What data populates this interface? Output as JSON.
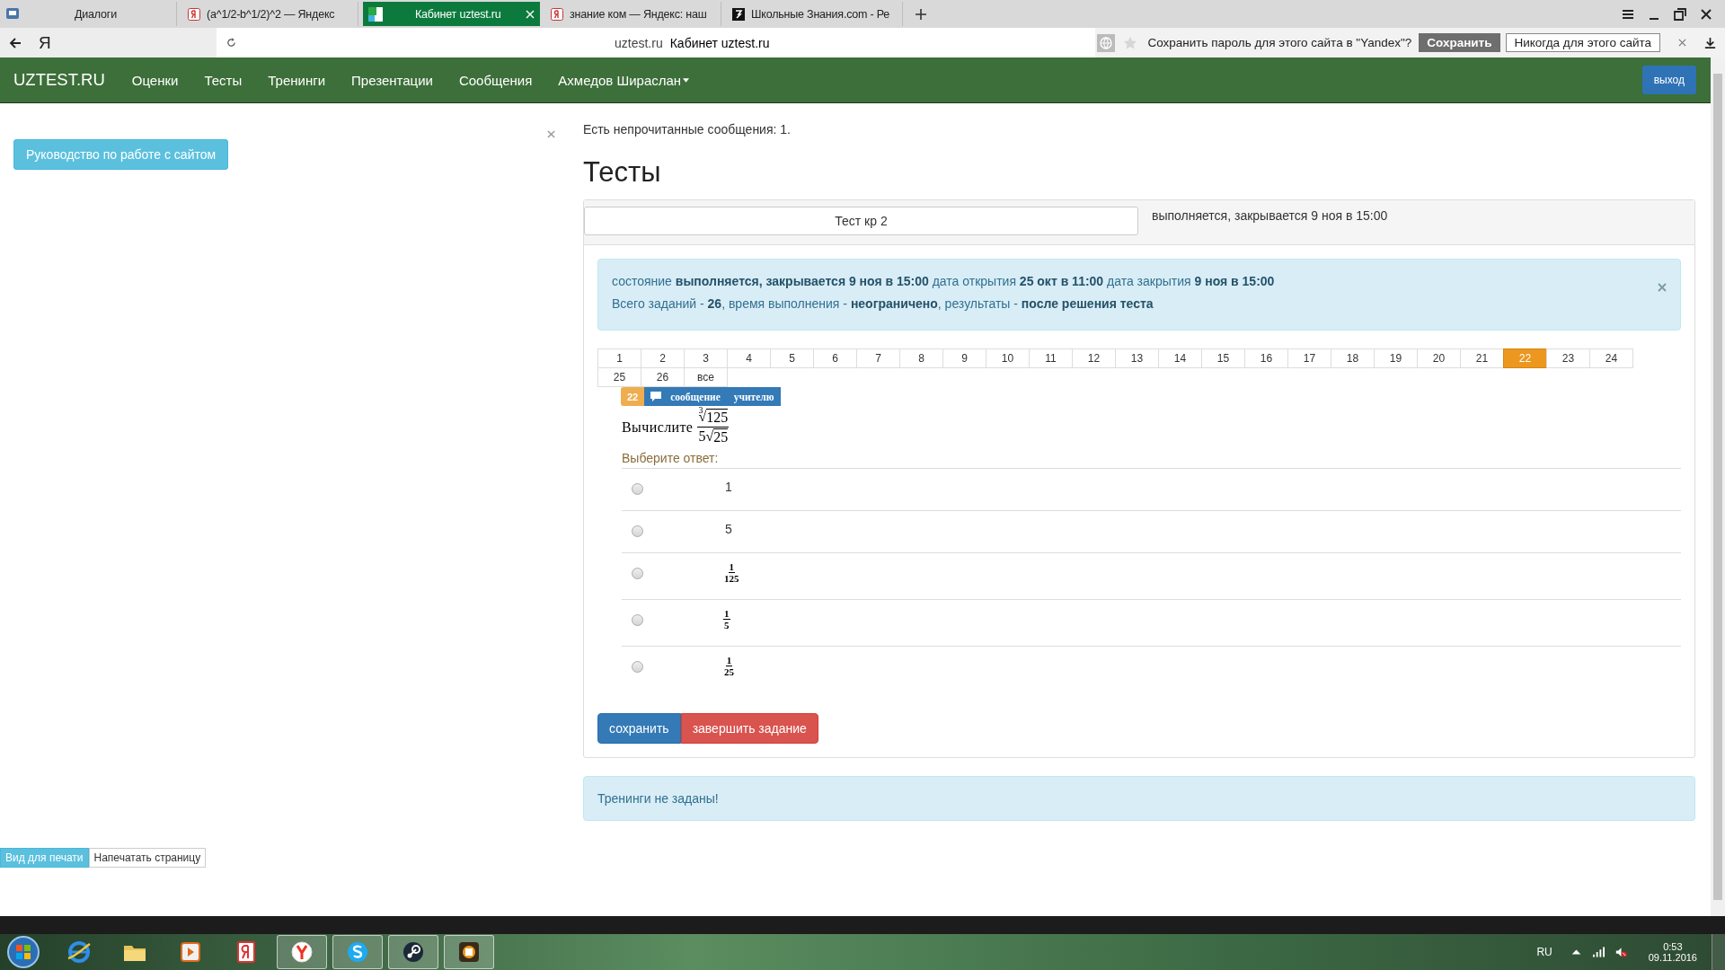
{
  "browser": {
    "tabs": [
      {
        "title": "Диалоги",
        "kind": "chat",
        "selected": false
      },
      {
        "title": "(a^1/2-b^1/2)^2 — Яндекс",
        "kind": "yandex",
        "selected": false
      },
      {
        "title": "Кабинет uztest.ru",
        "kind": "site",
        "selected": true
      },
      {
        "title": "знание ком — Яндекс: наш",
        "kind": "yandex",
        "selected": false
      },
      {
        "title": "Школьные Знания.com - Ре",
        "kind": "znanija",
        "selected": false
      }
    ],
    "logo": "Я",
    "domain": "uztest.ru",
    "page_title": "Кабинет uztest.ru",
    "password_prompt": {
      "text": "Сохранить пароль для этого сайта в \"Yandex\"?",
      "save": "Сохранить",
      "never": "Никогда для этого сайта"
    }
  },
  "navbar": {
    "brand": "UZTEST.RU",
    "items": [
      "Оценки",
      "Тесты",
      "Тренинги",
      "Презентации",
      "Сообщения"
    ],
    "user": "Ахмедов Шираслан",
    "logout": "выход"
  },
  "sidebar": {
    "guide_button": "Руководство по работе с сайтом"
  },
  "notice": "Есть непрочитанные сообщения: 1.",
  "heading": "Тесты",
  "test": {
    "name": "Тест кр 2",
    "status": "выполняется, закрывается 9 ноя в 15:00",
    "info": [
      "состояние **выполняется, закрывается 9 ноя в 15:00** дата открытия **25 окт в 11:00** дата закрытия **9 ноя в 15:00**",
      "Всего заданий - **26**, время выполнения - **неограничено**, результаты - **после решения теста**"
    ],
    "pages": [
      {
        "label": "1",
        "selected": false
      },
      {
        "label": "2",
        "selected": false
      },
      {
        "label": "3",
        "selected": false
      },
      {
        "label": "4",
        "selected": false
      },
      {
        "label": "5",
        "selected": false
      },
      {
        "label": "6",
        "selected": false
      },
      {
        "label": "7",
        "selected": false
      },
      {
        "label": "8",
        "selected": false
      },
      {
        "label": "9",
        "selected": false
      },
      {
        "label": "10",
        "selected": false
      },
      {
        "label": "11",
        "selected": false
      },
      {
        "label": "12",
        "selected": false
      },
      {
        "label": "13",
        "selected": false
      },
      {
        "label": "14",
        "selected": false
      },
      {
        "label": "15",
        "selected": false
      },
      {
        "label": "16",
        "selected": false
      },
      {
        "label": "17",
        "selected": false
      },
      {
        "label": "18",
        "selected": false
      },
      {
        "label": "19",
        "selected": false
      },
      {
        "label": "20",
        "selected": false
      },
      {
        "label": "21",
        "selected": false
      },
      {
        "label": "22",
        "selected": true
      },
      {
        "label": "23",
        "selected": false
      },
      {
        "label": "24",
        "selected": false
      },
      {
        "label": "25",
        "selected": false
      },
      {
        "label": "26",
        "selected": false
      },
      {
        "label": "все",
        "selected": false
      }
    ],
    "task_number": "22",
    "message_button": "сообщение учителю",
    "question": {
      "label": "Вычислите",
      "numerator": {
        "index": "3",
        "sign": "√",
        "radicand": "125"
      },
      "denominator": {
        "coefficient": "5",
        "sign": "√",
        "radicand": "25"
      }
    },
    "prompt": "Выберите ответ:",
    "answers": [
      {
        "kind": "number",
        "value": "1",
        "selected": false
      },
      {
        "kind": "number",
        "value": "5",
        "selected": false
      },
      {
        "kind": "fraction",
        "numerator": "1",
        "denominator": "125",
        "selected": false
      },
      {
        "kind": "fraction",
        "numerator": "1",
        "denominator": "5",
        "selected": false
      },
      {
        "kind": "fraction",
        "numerator": "1",
        "denominator": "25",
        "selected": false
      }
    ],
    "save": "сохранить",
    "finish": "завершить задание"
  },
  "trainings_notice": "Тренинги не заданы!",
  "print_buttons": [
    {
      "label": "Вид для печати",
      "selected": true
    },
    {
      "label": "Напечатать страницу",
      "selected": false
    }
  ],
  "taskbar": {
    "apps": [
      {
        "kind": "ie",
        "running": false
      },
      {
        "kind": "folder",
        "running": false
      },
      {
        "kind": "media",
        "running": false
      },
      {
        "kind": "yandex",
        "running": false
      },
      {
        "kind": "ybrowser",
        "running": true
      },
      {
        "kind": "skype",
        "running": true
      },
      {
        "kind": "steam",
        "running": true
      },
      {
        "kind": "game",
        "running": true
      }
    ],
    "language": "RU",
    "time": "0:53",
    "date": "09.11.2016"
  }
}
